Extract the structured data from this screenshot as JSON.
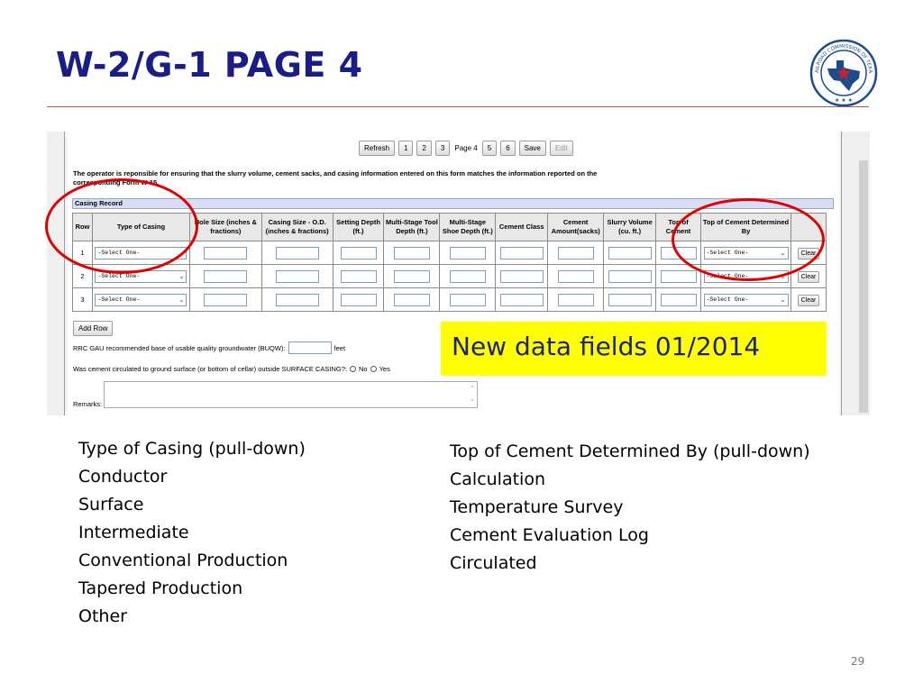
{
  "title": "W-2/G-1 PAGE 4",
  "seal": {
    "icon": "railroad-commission-seal",
    "text": "RAILROAD COMMISSION OF TEXAS",
    "color": "#1b4c8c"
  },
  "form": {
    "buttons": {
      "refresh": "Refresh",
      "p1": "1",
      "p2": "2",
      "p3": "3",
      "current_page": "Page 4",
      "p5": "5",
      "p6": "6",
      "save": "Save",
      "edit": "Edit"
    },
    "notice": "The operator is reponsible for ensuring that the slurry volume, cement sacks, and casing information entered on this form matches the information reported on the corresponding Form W-15.",
    "record_title": "Casing Record",
    "columns": [
      "Row",
      "Type of Casing",
      "Hole Size (inches & fractions)",
      "Casing Size - O.D. (inches & fractions)",
      "Setting Depth (ft.)",
      "Multi-Stage Tool Depth (ft.)",
      "Multi-Stage Shoe Depth (ft.)",
      "Cement Class",
      "Cement Amount(sacks)",
      "Slurry Volume (cu. ft.)",
      "Top of Cement",
      "Top of Cement Determined By"
    ],
    "rows": [
      {
        "num": "1",
        "casing_type": "-Select One-",
        "determined_by": "-Select One-",
        "clear": "Clear"
      },
      {
        "num": "2",
        "casing_type": "-Select One-",
        "determined_by": "-Select One-",
        "clear": "Clear"
      },
      {
        "num": "3",
        "casing_type": "-Select One-",
        "determined_by": "-Select One-",
        "clear": "Clear"
      }
    ],
    "add_row": "Add Row",
    "buqw_label": "RRC GAU recommended base of usable quality groundwater (BUQW):",
    "buqw_unit": "feet",
    "circulated_label": "Was cement circulated to ground surface (or bottom of cellar) outside SURFACE CASING?:",
    "circulated_options": [
      "No",
      "Yes"
    ],
    "remarks_label": "Remarks:"
  },
  "callout": "New data fields 01/2014",
  "annotation_color": "#e00000",
  "left_list": {
    "heading": "Type of Casing (pull-down)",
    "items": [
      "Conductor",
      "Surface",
      "Intermediate",
      "Conventional Production",
      "Tapered Production",
      "Other"
    ]
  },
  "right_list": {
    "heading": "Top of Cement Determined By (pull-down)",
    "items": [
      "Calculation",
      "Temperature Survey",
      "Cement Evaluation Log",
      "Circulated"
    ]
  },
  "page_number": "29"
}
